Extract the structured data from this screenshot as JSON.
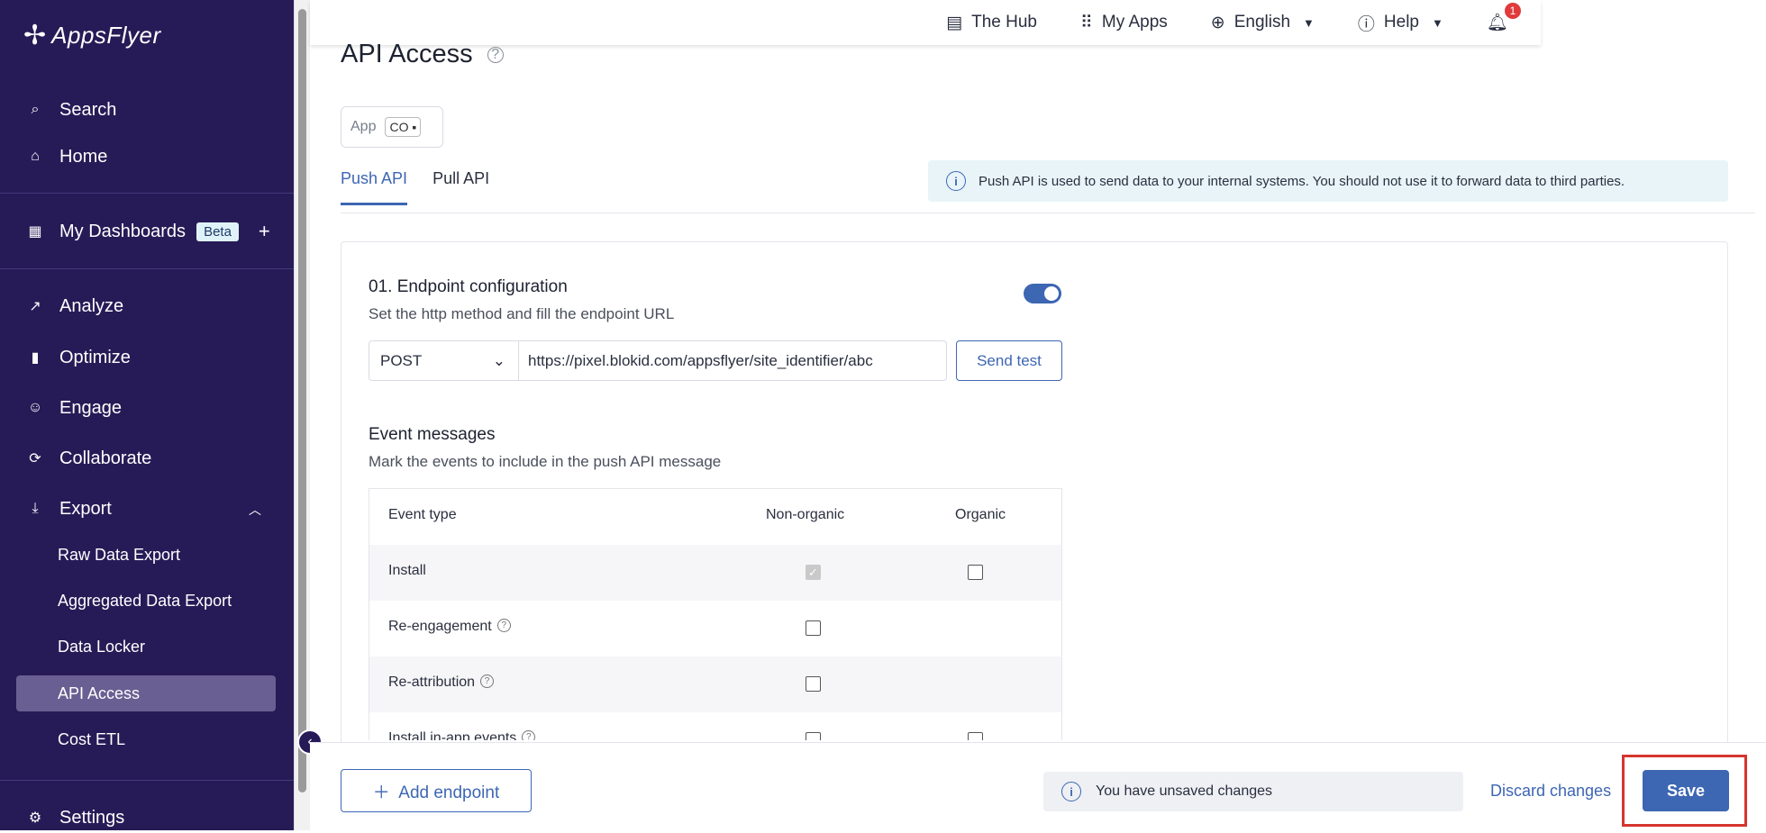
{
  "brand": {
    "name": "AppsFlyer"
  },
  "sidebar": {
    "search": "Search",
    "home": "Home",
    "dashboards": "My Dashboards",
    "beta": "Beta",
    "analyze": "Analyze",
    "optimize": "Optimize",
    "engage": "Engage",
    "collaborate": "Collaborate",
    "export": "Export",
    "export_items": [
      "Raw Data Export",
      "Aggregated Data Export",
      "Data Locker",
      "API Access",
      "Cost ETL"
    ],
    "settings": "Settings"
  },
  "topbar": {
    "hub": "The Hub",
    "myapps": "My Apps",
    "language": "English",
    "help": "Help",
    "notifications_count": "1"
  },
  "page": {
    "title": "API Access",
    "app_label": "App",
    "app_chip": "CO"
  },
  "tabs": [
    "Push API",
    "Pull API"
  ],
  "info_banner": "Push API is used to send data to your internal systems. You should not use it to forward data to third parties.",
  "endpoint": {
    "title": "01. Endpoint configuration",
    "subtitle": "Set the http method and fill the endpoint URL",
    "method": "POST",
    "url": "https://pixel.blokid.com/appsflyer/site_identifier/abc",
    "send_test": "Send test"
  },
  "events": {
    "title": "Event messages",
    "subtitle": "Mark the events to include in the push API message",
    "headers": [
      "Event type",
      "Non-organic",
      "Organic"
    ],
    "rows": [
      {
        "label": "Install",
        "non_organic": "checked-disabled",
        "organic": "unchecked"
      },
      {
        "label": "Re-engagement",
        "non_organic": "unchecked",
        "organic": "none"
      },
      {
        "label": "Re-attribution",
        "non_organic": "unchecked",
        "organic": "none"
      },
      {
        "label": "Install in-app events",
        "non_organic": "unchecked",
        "organic": "unchecked"
      }
    ]
  },
  "footer": {
    "add_endpoint": "Add endpoint",
    "unsaved": "You have unsaved changes",
    "discard": "Discard changes",
    "save": "Save"
  },
  "colors": {
    "sidebar": "#271b57",
    "accent": "#3d66b3",
    "highlight": "#d6342f"
  }
}
